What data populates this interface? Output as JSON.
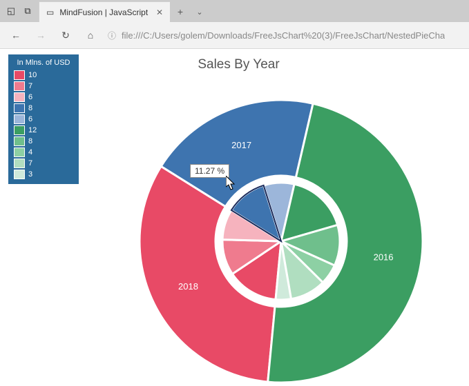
{
  "browser": {
    "tab_title": "MindFusion | JavaScript",
    "url": "file:///C:/Users/golem/Downloads/FreeJsChart%20(3)/FreeJsChart/NestedPieCha",
    "icons": {
      "win_left1": "recent-icon",
      "win_left2": "set-aside-icon",
      "tab_close": "close-icon",
      "new_tab": "plus-icon",
      "more_tabs": "chevron-down-icon",
      "back": "back-icon",
      "forward": "forward-icon",
      "refresh": "refresh-icon",
      "home": "home-icon",
      "info": "info-icon"
    }
  },
  "chart": {
    "title": "Sales By Year",
    "tooltip": "11.27 %",
    "legend_title": "In Mlns. of USD",
    "legend": [
      {
        "color": "#e84a66",
        "label": "10"
      },
      {
        "color": "#ef7b8e",
        "label": "7"
      },
      {
        "color": "#f6b3be",
        "label": "6"
      },
      {
        "color": "#3e74af",
        "label": "8"
      },
      {
        "color": "#9cb6da",
        "label": "6"
      },
      {
        "color": "#3b9e62",
        "label": "12"
      },
      {
        "color": "#6fbf8c",
        "label": "8"
      },
      {
        "color": "#8dd0a4",
        "label": "4"
      },
      {
        "color": "#b0dec0",
        "label": "7"
      },
      {
        "color": "#cfeadb",
        "label": "3"
      }
    ],
    "outer_labels": {
      "y2016": "2016",
      "y2017": "2017",
      "y2018": "2018"
    }
  },
  "chart_data": {
    "type": "pie",
    "title": "Sales By Year",
    "units": "Millions of USD",
    "tooltip_segment": {
      "year": "2017",
      "subvalue": 8,
      "percent": 11.27
    },
    "rings": [
      {
        "name": "outer",
        "series": [
          {
            "name": "2018",
            "value": 23,
            "color": "#e84a66"
          },
          {
            "name": "2017",
            "value": 14,
            "color": "#3e74af"
          },
          {
            "name": "2016",
            "value": 34,
            "color": "#3b9e62"
          }
        ]
      },
      {
        "name": "inner",
        "series": [
          {
            "year": "2018",
            "value": 10,
            "color": "#e84a66"
          },
          {
            "year": "2018",
            "value": 7,
            "color": "#ef7b8e"
          },
          {
            "year": "2018",
            "value": 6,
            "color": "#f6b3be"
          },
          {
            "year": "2017",
            "value": 8,
            "color": "#3e74af"
          },
          {
            "year": "2017",
            "value": 6,
            "color": "#9cb6da"
          },
          {
            "year": "2016",
            "value": 12,
            "color": "#3b9e62"
          },
          {
            "year": "2016",
            "value": 8,
            "color": "#6fbf8c"
          },
          {
            "year": "2016",
            "value": 4,
            "color": "#8dd0a4"
          },
          {
            "year": "2016",
            "value": 7,
            "color": "#b0dec0"
          },
          {
            "year": "2016",
            "value": 3,
            "color": "#cfeadb"
          }
        ]
      }
    ]
  }
}
